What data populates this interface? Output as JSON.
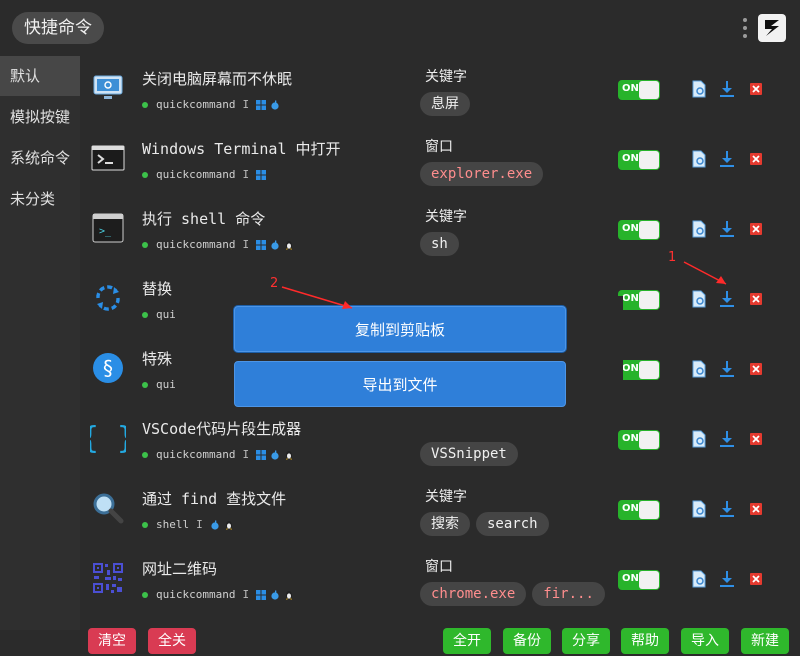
{
  "app": {
    "title": "快捷命令"
  },
  "sidebar": {
    "items": [
      {
        "label": "默认",
        "active": true
      },
      {
        "label": "模拟按键"
      },
      {
        "label": "系统命令"
      },
      {
        "label": "未分类"
      }
    ]
  },
  "commands": [
    {
      "title": "关闭电脑屏幕而不休眠",
      "author": "quickcommand",
      "platforms": [
        "windows",
        "apple"
      ],
      "kind": "关键字",
      "tags": [
        "息屏"
      ],
      "icon": "monitor-icon",
      "enabled_label": "ON"
    },
    {
      "title": "Windows Terminal 中打开",
      "author": "quickcommand",
      "platforms": [
        "windows"
      ],
      "kind": "窗口",
      "tags": [
        "explorer.exe"
      ],
      "icon": "terminal-icon",
      "enabled_label": "ON"
    },
    {
      "title": "执行 shell 命令",
      "author": "quickcommand",
      "platforms": [
        "windows",
        "apple",
        "linux"
      ],
      "kind": "关键字",
      "tags": [
        "sh"
      ],
      "icon": "shell-icon",
      "enabled_label": "ON"
    },
    {
      "title": "替换",
      "author": "quic",
      "platforms": [],
      "kind": "",
      "tags": [],
      "icon": "replace-icon",
      "enabled_label": "ON"
    },
    {
      "title": "特殊",
      "author": "qui",
      "platforms": [],
      "kind": "",
      "tags": [],
      "icon": "section-icon",
      "enabled_label": "ON"
    },
    {
      "title": "VSCode代码片段生成器",
      "author": "quickcommand",
      "platforms": [
        "windows",
        "apple",
        "linux"
      ],
      "kind": "",
      "tags": [
        "VSSnippet"
      ],
      "icon": "braces-icon",
      "enabled_label": "ON"
    },
    {
      "title": "通过 find 查找文件",
      "author": "shell",
      "platforms": [
        "apple",
        "linux"
      ],
      "kind": "关键字",
      "tags": [
        "搜索",
        "search"
      ],
      "icon": "magnifier-icon",
      "enabled_label": "ON"
    },
    {
      "title": "网址二维码",
      "author": "quickcommand",
      "platforms": [
        "windows",
        "apple",
        "linux"
      ],
      "kind": "窗口",
      "tags": [
        "chrome.exe",
        "fir..."
      ],
      "icon": "qrcode-icon",
      "enabled_label": "ON"
    }
  ],
  "popup": {
    "copy_label": "复制到剪贴板",
    "export_label": "导出到文件"
  },
  "annotations": {
    "one": "1",
    "two": "2"
  },
  "bottom": {
    "clear": "清空",
    "close_all": "全关",
    "open_all": "全开",
    "backup": "备份",
    "share": "分享",
    "help": "帮助",
    "import": "导入",
    "new": "新建"
  },
  "colors": {
    "accent_green": "#27b32b",
    "danger_red": "#d93b53",
    "popup_blue": "#2f7fd9",
    "tag_bg": "#454545"
  }
}
